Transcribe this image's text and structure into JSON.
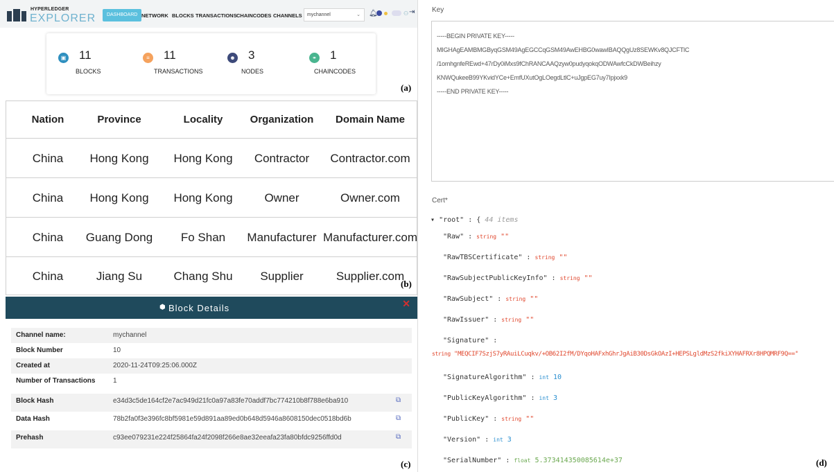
{
  "header": {
    "logo_top": "HYPERLEDGER",
    "logo_main": "EXPLORER",
    "nav": [
      "DASHBOARD",
      "NETWORK",
      "BLOCKS",
      "TRANSACTIONS",
      "CHAINCODES",
      "CHANNELS"
    ],
    "channel_select": "mychannel"
  },
  "stats": [
    {
      "value": "11",
      "label": "BLOCKS",
      "icon": "cube-icon",
      "color": "#2e8fbf"
    },
    {
      "value": "11",
      "label": "TRANSACTIONS",
      "icon": "list-icon",
      "color": "#f5a25d"
    },
    {
      "value": "3",
      "label": "NODES",
      "icon": "users-icon",
      "color": "#3d4a7a"
    },
    {
      "value": "1",
      "label": "CHAINCODES",
      "icon": "handshake-icon",
      "color": "#49b58f"
    }
  ],
  "tags": {
    "a": "(a)",
    "b": "(b)",
    "c": "(c)",
    "d": "(d)"
  },
  "org_table": {
    "headers": [
      "Nation",
      "Province",
      "Locality",
      "Organization",
      "Domain Name"
    ],
    "rows": [
      [
        "China",
        "Hong Kong",
        "Hong Kong",
        "Contractor",
        "Contractor.com"
      ],
      [
        "China",
        "Hong Kong",
        "Hong Kong",
        "Owner",
        "Owner.com"
      ],
      [
        "China",
        "Guang Dong",
        "Fo Shan",
        "Manufacturer",
        "Manufacturer.com"
      ],
      [
        "China",
        "Jiang Su",
        "Chang Shu",
        "Supplier",
        "Supplier.com"
      ]
    ]
  },
  "block_details": {
    "title": "Block Details",
    "rows": [
      {
        "key": "Channel name:",
        "value": "mychannel"
      },
      {
        "key": "Block Number",
        "value": "10"
      },
      {
        "key": "Created at",
        "value": "2020-11-24T09:25:06.000Z"
      },
      {
        "key": "Number of Transactions",
        "value": "1"
      },
      {
        "key": "Block Hash",
        "value": "e34d3c5de164cf2e7ac949d21fc0a97a83fe70addf7bc774210b8f788e6ba910"
      },
      {
        "key": "Data Hash",
        "value": "78b2fa0f3e396fc8bf5981e59d891aa89ed0b648d5946a8608150dec0518bd6b"
      },
      {
        "key": "Prehash",
        "value": "c93ee079231e224f25864fa24f2098f266e8ae32eeafa23fa80bfdc9256ffd0d"
      }
    ]
  },
  "key_panel": {
    "label": "Key",
    "lines": [
      "-----BEGIN PRIVATE KEY-----",
      "MIGHAgEAMBMGByqGSM49AgEGCCqGSM49AwEHBG0wawIBAQQgUz8SEWKv8QJCFTlC",
      "/1omhgnfeREwd+47rDy0iMxs9fChRANCAAQzyw0pudyqokqODWAwfcCkDWBeihzy",
      "KNWQukeeB99YKvidYCe+EmfUXutOgLOegdLtlC+uJgpEG7uy7Ipjxxk9",
      "-----END PRIVATE KEY-----"
    ]
  },
  "cert_panel": {
    "label": "Cert*",
    "root_key": "\"root\"",
    "root_count": "44 items",
    "fields": [
      {
        "key": "\"Raw\"",
        "type": "string",
        "value": "\"\""
      },
      {
        "key": "\"RawTBSCertificate\"",
        "type": "string",
        "value": "\"\""
      },
      {
        "key": "\"RawSubjectPublicKeyInfo\"",
        "type": "string",
        "value": "\"\""
      },
      {
        "key": "\"RawSubject\"",
        "type": "string",
        "value": "\"\""
      },
      {
        "key": "\"RawIssuer\"",
        "type": "string",
        "value": "\"\""
      },
      {
        "key": "\"Signature\"",
        "type": "string",
        "value": "\"MEQCIF7SzjS7yRAuiLCuqkv/+OB62I2fM/DYqoHAFxhGhrJgAiB30DsGkOAzI+HEPSLgldMzS2fkiXYHAFRXr8HPQMRF9Q==\""
      },
      {
        "key": "\"SignatureAlgorithm\"",
        "type": "int",
        "value": "10"
      },
      {
        "key": "\"PublicKeyAlgorithm\"",
        "type": "int",
        "value": "3"
      },
      {
        "key": "\"PublicKey\"",
        "type": "string",
        "value": "\"\""
      },
      {
        "key": "\"Version\"",
        "type": "int",
        "value": "3"
      },
      {
        "key": "\"SerialNumber\"",
        "type": "float",
        "value": "5.373414350085614e+37"
      }
    ]
  }
}
